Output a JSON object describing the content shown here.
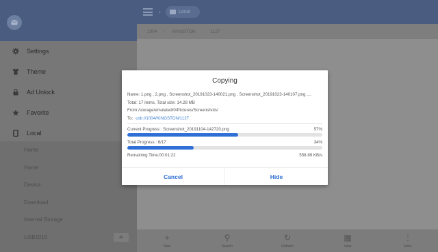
{
  "drawer": {
    "menu": [
      {
        "label": "Settings",
        "icon": "gear-icon"
      },
      {
        "label": "Theme",
        "icon": "shirt-icon"
      },
      {
        "label": "Ad Unlock",
        "icon": "lock-icon"
      },
      {
        "label": "Favorite",
        "icon": "star-icon"
      },
      {
        "label": "Local",
        "icon": "phone-icon"
      }
    ],
    "sub_items": [
      "Home",
      "Home",
      "Device",
      "Download",
      "Internal Storage",
      "USB1015"
    ],
    "eject_icon": "eject-icon"
  },
  "topbar": {
    "location_label": "Local",
    "path": [
      "1004",
      "KINGSTON",
      "1127"
    ]
  },
  "bottombar": [
    {
      "label": "New",
      "glyph": "+"
    },
    {
      "label": "Search",
      "glyph": "⚲"
    },
    {
      "label": "Refresh",
      "glyph": "↻"
    },
    {
      "label": "View",
      "glyph": "▦"
    },
    {
      "label": "More",
      "glyph": "⋮"
    }
  ],
  "dialog": {
    "title": "Copying",
    "name_line": "Name: 1.png , 2.png , Screenshot_20191023-140021.png , Screenshot_20191023-140107.png ,...",
    "total_line": "Total: 17 items, Total size: 14.28 MB",
    "from_line": "From:/storage/emulated/0/Pictures/Screenshots/",
    "to_label": "To:",
    "to_path": "usb://1004/KINGSTON/1127",
    "current_label": "Current Progress : Screenshot_20191104-142720.png",
    "current_percent": "57%",
    "current_value": 0.57,
    "total_label": "Total Progress : 6/17",
    "total_percent": "34%",
    "total_value": 0.34,
    "remaining": "Remaining Time:00:01:22",
    "speed": "558.89 KB/s",
    "cancel_label": "Cancel",
    "hide_label": "Hide"
  },
  "colors": {
    "accent": "#2f6fd6",
    "header": "#4a5d80",
    "link": "#3b7fd0"
  }
}
